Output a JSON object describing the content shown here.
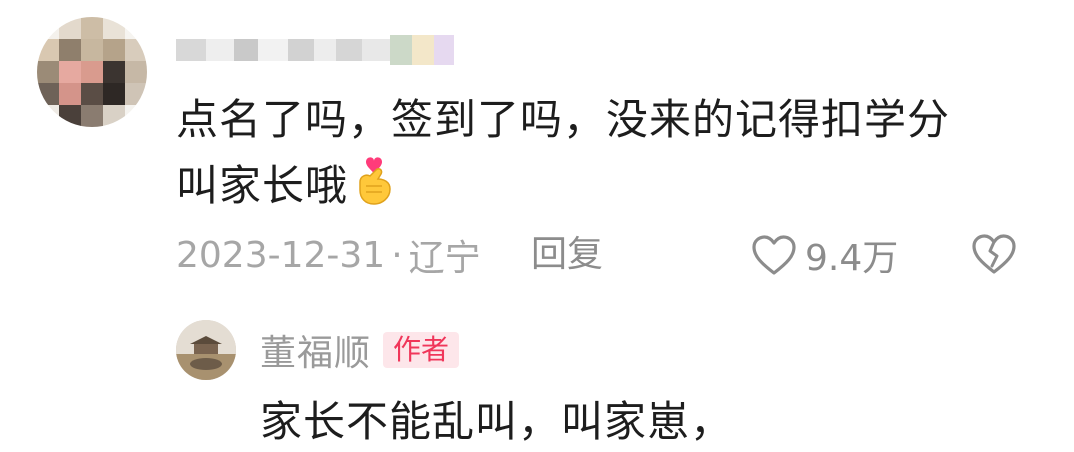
{
  "comment": {
    "line1": "点名了吗，签到了吗，没来的记得扣学分",
    "line2": "叫家长哦",
    "date": "2023-12-31",
    "separator": "·",
    "location": "辽宁",
    "reply_label": "回复",
    "like_count": "9.4万"
  },
  "reply": {
    "author": "董福顺",
    "badge": "作者",
    "text": "家长不能乱叫，叫家崽，"
  },
  "colors": {
    "text_primary": "#1d1d1d",
    "text_meta": "#a6a6a6",
    "badge_bg": "#fde6ea",
    "badge_text": "#f0365a",
    "heart_emoji": "#ff3b7a",
    "hand_emoji": "#ffc83a"
  },
  "icons": [
    "heart-outline-icon",
    "broken-heart-icon",
    "finger-heart-emoji"
  ]
}
